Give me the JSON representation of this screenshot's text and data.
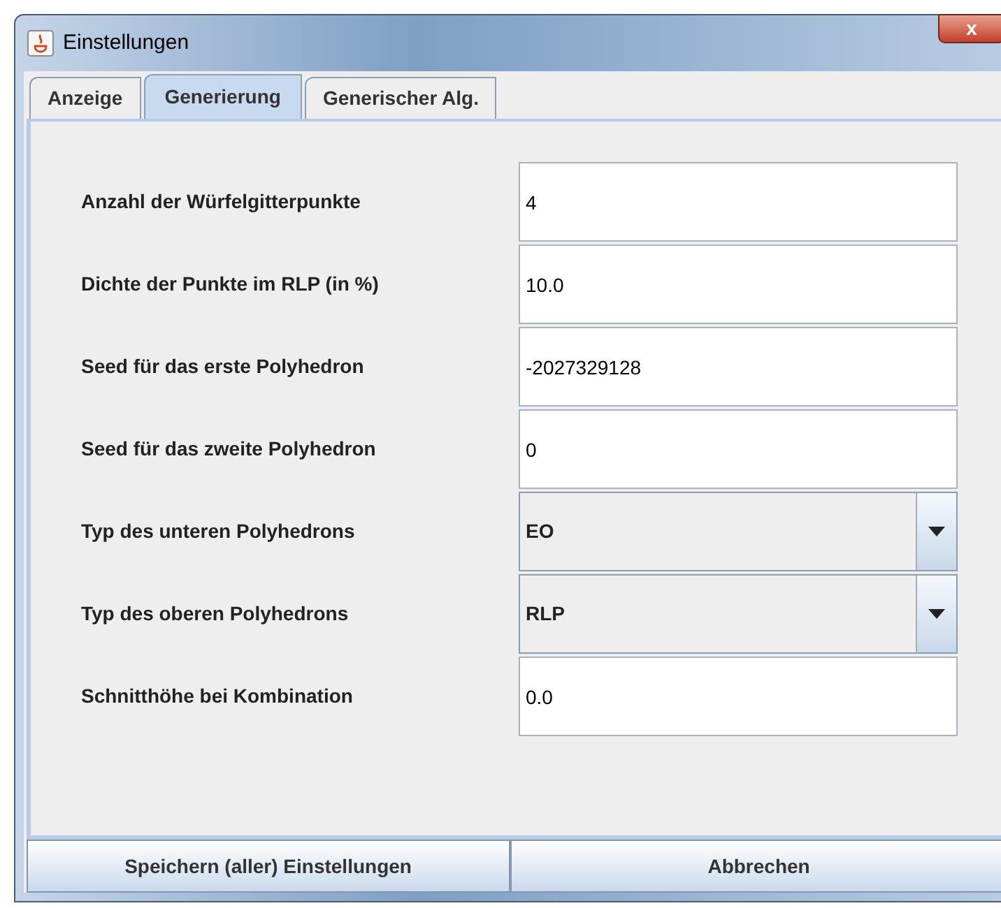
{
  "window": {
    "title": "Einstellungen",
    "close": "x"
  },
  "tabs": [
    {
      "label": "Anzeige",
      "selected": false
    },
    {
      "label": "Generierung",
      "selected": true
    },
    {
      "label": "Generischer Alg.",
      "selected": false
    }
  ],
  "settings": [
    {
      "label": "Anzahl der Würfelgitterpunkte",
      "kind": "text",
      "value": "4"
    },
    {
      "label": "Dichte der Punkte im RLP (in %)",
      "kind": "text",
      "value": "10.0"
    },
    {
      "label": "Seed für das erste Polyhedron",
      "kind": "text",
      "value": "-2027329128"
    },
    {
      "label": "Seed für das zweite Polyhedron",
      "kind": "text",
      "value": "0"
    },
    {
      "label": "Typ des unteren Polyhedrons",
      "kind": "combo",
      "value": "EO"
    },
    {
      "label": "Typ des oberen Polyhedrons",
      "kind": "combo",
      "value": "RLP"
    },
    {
      "label": "Schnitthöhe bei Kombination",
      "kind": "text",
      "value": "0.0"
    }
  ],
  "buttons": [
    "Speichern (aller) Einstellungen",
    "Abbrechen"
  ]
}
